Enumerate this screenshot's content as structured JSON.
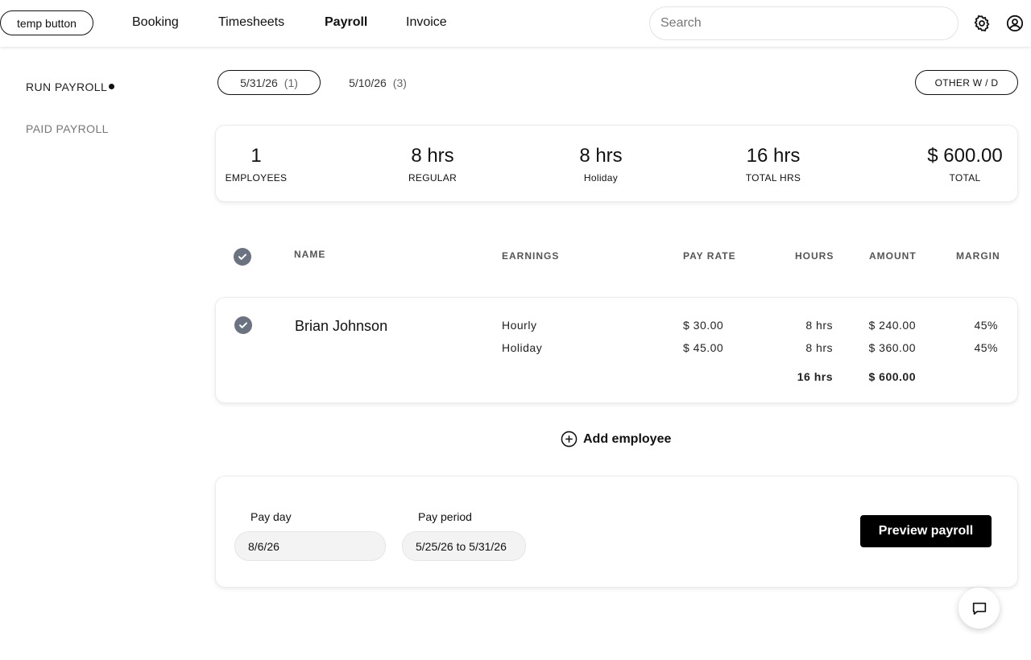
{
  "topbar": {
    "temp_button": "temp button",
    "nav": [
      {
        "label": "Booking",
        "active": false
      },
      {
        "label": "Timesheets",
        "active": false
      },
      {
        "label": "Payroll",
        "active": true
      },
      {
        "label": "Invoice",
        "active": false
      }
    ],
    "search_placeholder": "Search",
    "icons": [
      "gear-icon",
      "user-circle-icon"
    ]
  },
  "sidebar": {
    "items": [
      {
        "label": "RUN PAYROLL",
        "active": true
      },
      {
        "label": "PAID PAYROLL",
        "active": false
      }
    ]
  },
  "date_tabs": [
    {
      "date": "5/31/26",
      "count": "(1)",
      "selected": true
    },
    {
      "date": "5/10/26",
      "count": "(3)",
      "selected": false
    }
  ],
  "other_wd_button": "OTHER W / D",
  "summary": [
    {
      "value": "1",
      "label": "EMPLOYEES"
    },
    {
      "value": "8 hrs",
      "label": "REGULAR"
    },
    {
      "value": "8 hrs",
      "label": "Holiday"
    },
    {
      "value": "16 hrs",
      "label": "TOTAL HRS"
    },
    {
      "value": "$ 600.00",
      "label": "TOTAL"
    }
  ],
  "table": {
    "headers": {
      "name": "NAME",
      "earnings": "EARNINGS",
      "pay_rate": "PAY RATE",
      "hours": "HOURS",
      "amount": "AMOUNT",
      "margin": "MARGIN"
    },
    "rows": [
      {
        "name": "Brian Johnson",
        "checked": true,
        "lines": [
          {
            "earning": "Hourly",
            "pay_rate": "$ 30.00",
            "hours": "8 hrs",
            "amount": "$ 240.00",
            "margin": "45%"
          },
          {
            "earning": "Holiday",
            "pay_rate": "$ 45.00",
            "hours": "8 hrs",
            "amount": "$ 360.00",
            "margin": "45%"
          }
        ],
        "total_hours": "16 hrs",
        "total_amount": "$ 600.00"
      }
    ]
  },
  "add_employee_label": "Add employee",
  "footer": {
    "pay_day_label": "Pay day",
    "pay_day_value": "8/6/26",
    "pay_period_label": "Pay period",
    "pay_period_value": "5/25/26 to 5/31/26",
    "preview_button": "Preview payroll"
  },
  "colors": {
    "accent": "#000000",
    "check_bg": "#6b7280",
    "muted_text": "#777777"
  }
}
